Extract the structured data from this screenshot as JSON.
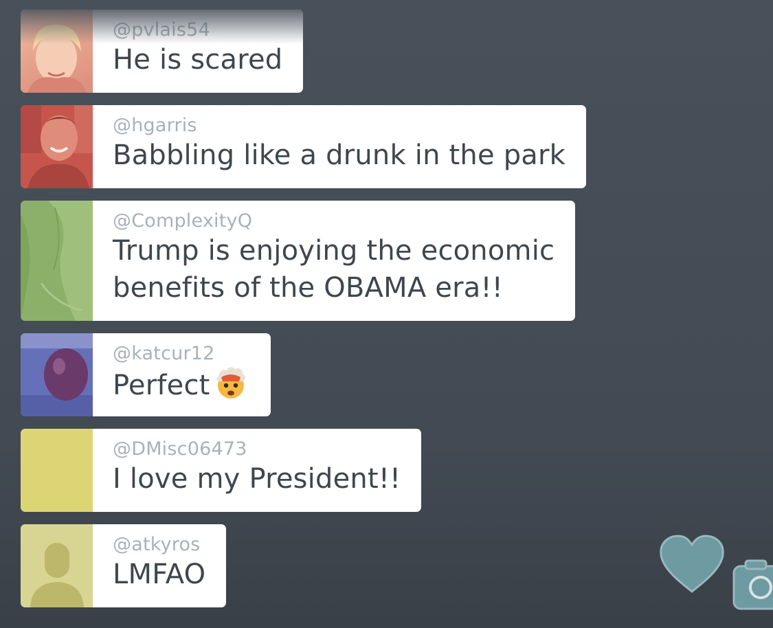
{
  "comments": [
    {
      "username": "@pvlais54",
      "message": "He is scared",
      "avatar": "photo-avatar-peach"
    },
    {
      "username": "@hgarris",
      "message": "Babbling like a drunk in the park",
      "avatar": "photo-avatar-red"
    },
    {
      "username": "@ComplexityQ",
      "message_line1": "Trump is enjoying the economic",
      "message_line2": "benefits of the OBAMA era!!",
      "avatar": "photo-avatar-green"
    },
    {
      "username": "@katcur12",
      "message": "Perfect",
      "emoji": "exploding-head-emoji",
      "avatar": "photo-avatar-blue"
    },
    {
      "username": "@DMisc06473",
      "message": "I love my President!!",
      "avatar": "solid-avatar-yellow"
    },
    {
      "username": "@atkyros",
      "message": "LMFAO",
      "avatar": "default-person-avatar-yellow"
    }
  ],
  "actions": {
    "heart_icon": "heart-icon",
    "camera_icon": "camera-icon"
  },
  "colors": {
    "background": "#454c55",
    "username": "#a9b1b8",
    "message": "#3f464d",
    "heart": "#6e9aa1",
    "avatar_peach": "#e7a58f",
    "avatar_red": "#c9554d",
    "avatar_green": "#8bb068",
    "avatar_blue": "#5e68b4",
    "avatar_yellow": "#ddd574",
    "avatar_default": "#d8d592"
  }
}
